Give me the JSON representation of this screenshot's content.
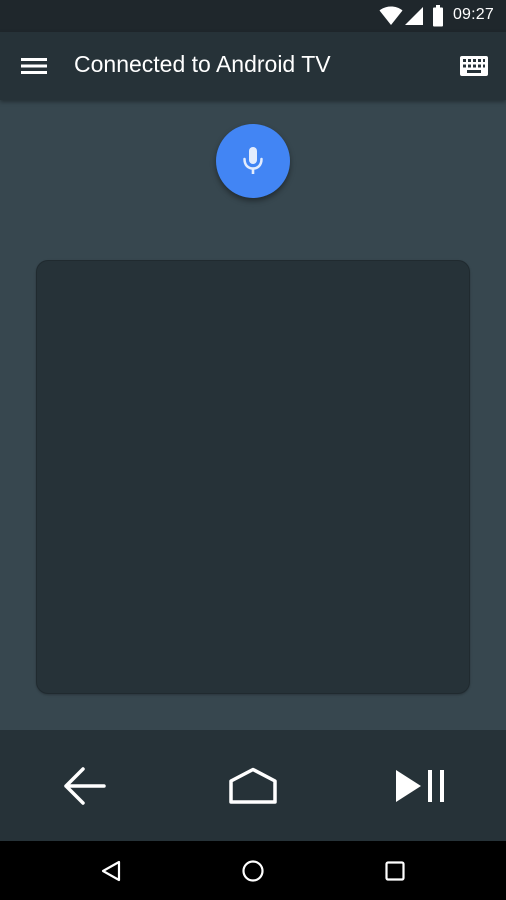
{
  "status_bar": {
    "time": "09:27",
    "icons": [
      "wifi-icon",
      "cell-signal-icon",
      "battery-icon"
    ]
  },
  "app_bar": {
    "title": "Connected to Android TV",
    "left_icon": "menu-icon",
    "right_icon": "keyboard-icon"
  },
  "mic": {
    "icon": "microphone-icon",
    "color": "#4285f4"
  },
  "touchpad": {
    "color": "#263238"
  },
  "controls": {
    "icons": [
      "back-arrow-icon",
      "home-icon",
      "play-pause-icon"
    ]
  },
  "nav_bar": {
    "icons": [
      "nav-back-icon",
      "nav-home-icon",
      "nav-recents-icon"
    ]
  },
  "colors": {
    "background": "#37474f",
    "app_bar": "#263238",
    "status_bar": "#1f272c",
    "accent": "#4285f4"
  }
}
